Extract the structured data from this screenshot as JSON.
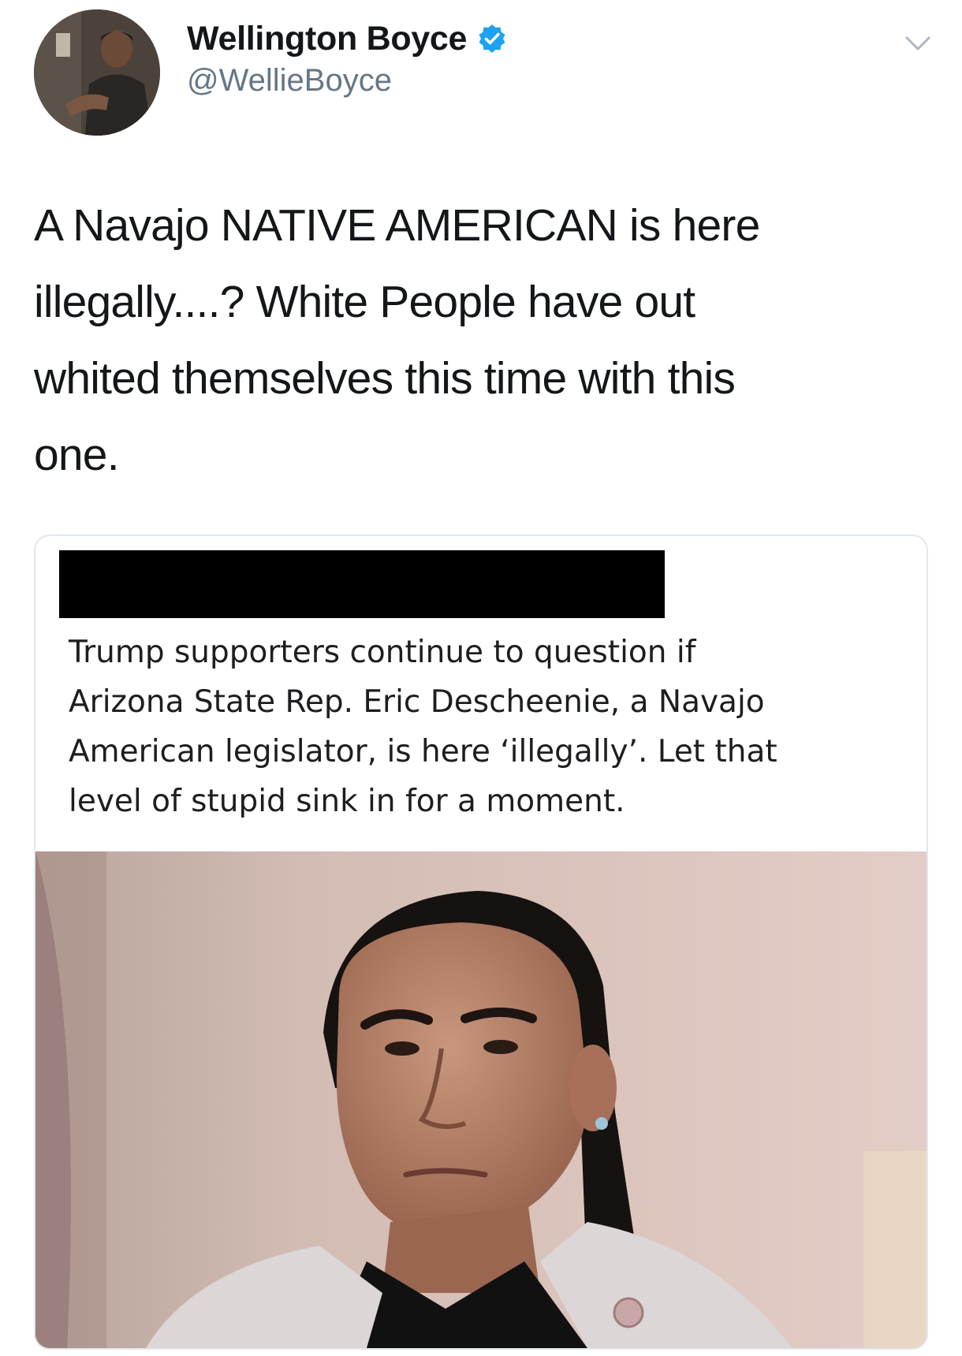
{
  "tweet": {
    "author": {
      "display_name": "Wellington Boyce",
      "handle": "@WellieBoyce",
      "verified": true,
      "avatar_icon": "profile-photo-icon"
    },
    "menu_icon": "chevron-down-icon",
    "text": "A Navajo NATIVE AMERICAN is here\nillegally....? White People have out\nwhited themselves this time with this\none.",
    "embedded_card": {
      "header_redacted": true,
      "text": "Trump supporters continue to question if\nArizona State Rep. Eric Descheenie, a Navajo\nAmerican legislator, is here ‘illegally’. Let that\nlevel of stupid sink in for a moment.",
      "photo_icon": "portrait-photo-icon"
    }
  },
  "colors": {
    "text_primary": "#14171a",
    "text_secondary": "#657786",
    "verified_blue": "#1da1f2",
    "card_border": "#e1e8ed",
    "redaction": "#000000"
  }
}
